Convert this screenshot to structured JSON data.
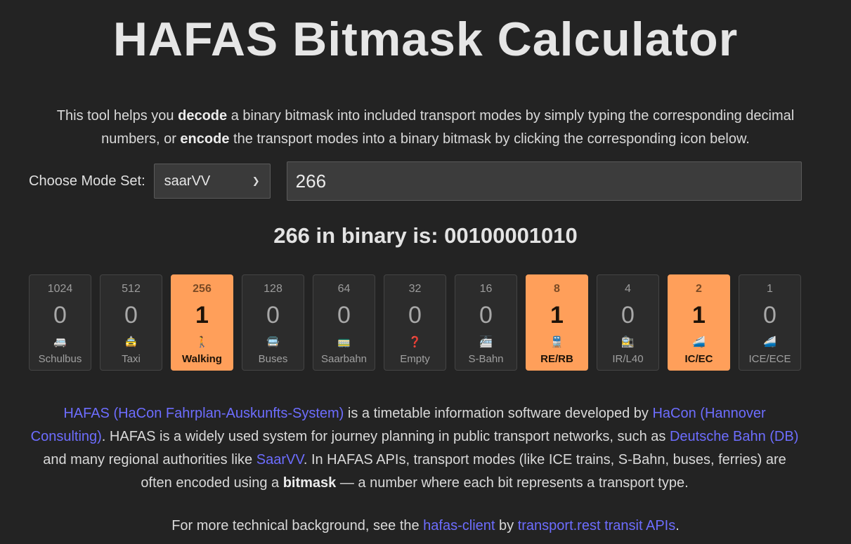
{
  "title": "HAFAS Bitmask Calculator",
  "intro": {
    "p1": "This tool helps you ",
    "b1": "decode",
    "p2": " a binary bitmask into included transport modes by simply typing the corresponding decimal numbers, or ",
    "b2": "encode",
    "p3": " the transport modes into a binary bitmask by clicking the corresponding icon below."
  },
  "controls": {
    "mode_label": "Choose Mode Set:",
    "mode_value": "saarVV",
    "decimal_value": "266"
  },
  "binary_line": "266 in binary is: 00100001010",
  "bits": [
    {
      "weight": "1024",
      "value": "0",
      "icon": "🚐",
      "name": "Schulbus",
      "active": false
    },
    {
      "weight": "512",
      "value": "0",
      "icon": "🚖",
      "name": "Taxi",
      "active": false
    },
    {
      "weight": "256",
      "value": "1",
      "icon": "🚶",
      "name": "Walking",
      "active": true
    },
    {
      "weight": "128",
      "value": "0",
      "icon": "🚍",
      "name": "Buses",
      "active": false
    },
    {
      "weight": "64",
      "value": "0",
      "icon": "🚃",
      "name": "Saarbahn",
      "active": false
    },
    {
      "weight": "32",
      "value": "0",
      "icon": "❓",
      "name": "Empty",
      "active": false
    },
    {
      "weight": "16",
      "value": "0",
      "icon": "🚈",
      "name": "S-Bahn",
      "active": false
    },
    {
      "weight": "8",
      "value": "1",
      "icon": "🚆",
      "name": "RE/RB",
      "active": true
    },
    {
      "weight": "4",
      "value": "0",
      "icon": "🚉",
      "name": "IR/L40",
      "active": false
    },
    {
      "weight": "2",
      "value": "1",
      "icon": "🚄",
      "name": "IC/EC",
      "active": true
    },
    {
      "weight": "1",
      "value": "0",
      "icon": "🚄",
      "name": "ICE/ECE",
      "active": false
    }
  ],
  "description": {
    "link1": "HAFAS (HaCon Fahrplan-Auskunfts-System)",
    "t1": " is a timetable information software developed by ",
    "link2": "HaCon (Hannover Consulting)",
    "t2": ". HAFAS is a widely used system for journey planning in public transport networks, such as ",
    "link3": "Deutsche Bahn (DB)",
    "t3": " and many regional authorities like ",
    "link4": "SaarVV",
    "t4": ". In HAFAS APIs, transport modes (like ICE trains, S-Bahn, buses, ferries) are often encoded using a ",
    "bold": "bitmask",
    "t5": " — a number where each bit represents a transport type."
  },
  "more": {
    "t1": "For more technical background, see the ",
    "link1": "hafas-client",
    "t2": " by ",
    "link2": "transport.rest transit APIs",
    "t3": "."
  },
  "colors": {
    "background": "#232323",
    "accent_active": "#ff9f5a",
    "link": "#6d6dff"
  }
}
